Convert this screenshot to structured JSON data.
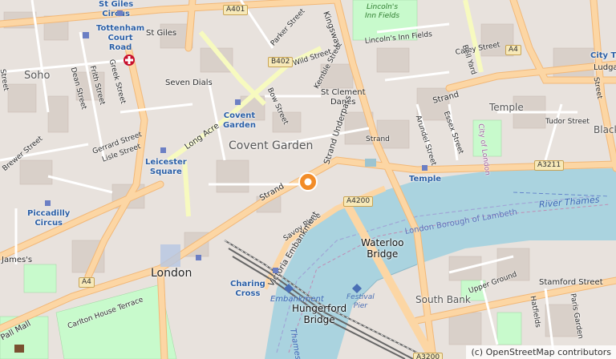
{
  "map": {
    "attribution": "(c) OpenStreetMap contributors",
    "districts": {
      "soho": "Soho",
      "covent_garden": "Covent Garden",
      "seven_dials": "Seven Dials",
      "st_giles": "St Giles",
      "st_clement_danes": "St Clement\nDanes",
      "temple_area": "Temple",
      "london": "London",
      "south_bank": "South Bank",
      "james": "James's",
      "black": "Black",
      "ludgate": "Ludga",
      "city": "City"
    },
    "streets": {
      "st_giles_circus": "St Giles\nCircus",
      "a401": "A401",
      "b402": "B402",
      "parker": "Parker Street",
      "wild": "Wild Street",
      "kemble": "Kemble Street",
      "kingsway": "Kingsway",
      "lincolns_inn_fields_st": "Lincoln's Inn Fields",
      "carey": "Carey Street",
      "bell_yard": "Bell Yard",
      "a4_top": "A4",
      "bow": "Bow Street",
      "long_acre": "Long Acre",
      "gerrard": "Gerrard Street",
      "lisle": "Lisle Street",
      "brewer": "Brewer Street",
      "dean": "Dean Street",
      "frith": "Frith Street",
      "greek": "Greek Street",
      "strand": "Strand",
      "strand_underpass": "Strand Underpass",
      "strand_small": "Strand",
      "arundel": "Arundel Street",
      "essex": "Essex Street",
      "strand_east": "Strand",
      "tudor": "Tudor Street",
      "a3211": "A3211",
      "a4200": "A4200",
      "savoy": "Savoy Place",
      "victoria_embankment": "Victoria Embankment",
      "a4_left": "A4",
      "carlton": "Carlton House Terrace",
      "pall_mall": "Pall Mall",
      "upper_ground": "Upper Ground",
      "stamford": "Stamford Street",
      "hatfields": "Hatfields",
      "paris_garden": "Paris Garden",
      "a3200": "A3200",
      "city_of_london": "City of London",
      "b_street": "Street",
      "b_street2": "Street"
    },
    "stations": {
      "tottenham": "Tottenham\nCourt\nRoad",
      "covent_garden": "Covent\nGarden",
      "leicester": "Leicester\nSquare",
      "piccadilly": "Piccadilly\nCircus",
      "charing_cross": "Charing\nCross",
      "temple": "Temple",
      "embankment": "Embankment",
      "city_thames": "City Tha"
    },
    "water": {
      "river_thames": "River Thames",
      "borough_lambeth": "London Borough of Lambeth",
      "thames_vertical": "Thames"
    },
    "parks": {
      "lincolns_inn": "Lincoln's\nInn Fields",
      "festival_pier": "Festival\nPier"
    },
    "bridges": {
      "waterloo": "Waterloo\nBridge",
      "hungerford": "Hungerford\nBridge"
    },
    "colors": {
      "water": "#aad3df",
      "park": "#c8facc",
      "road_primary": "#fcd6a4",
      "road_secondary": "#f7fabf",
      "building": "#d9d0c9",
      "marker": "#f28c28"
    },
    "marker_icon": "location-pin-icon"
  }
}
